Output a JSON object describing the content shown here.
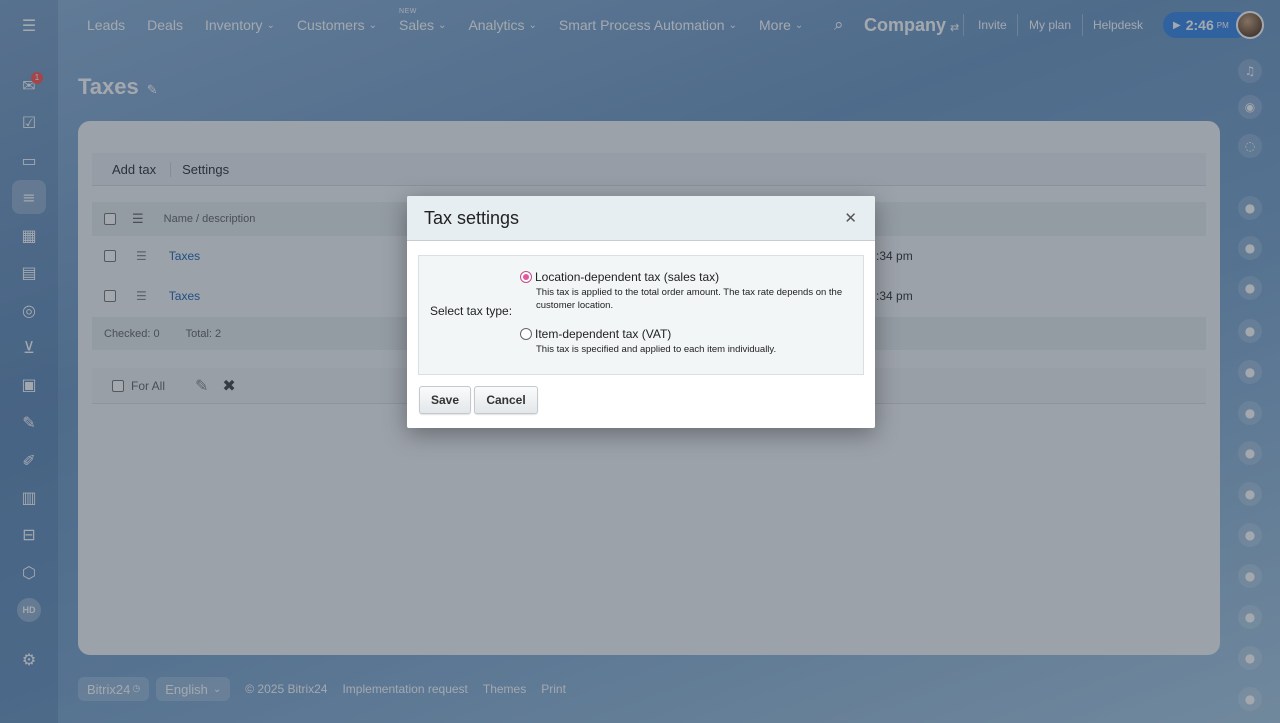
{
  "topnav": {
    "items": [
      {
        "label": "Leads",
        "chevron": false,
        "new": ""
      },
      {
        "label": "Deals",
        "chevron": false,
        "new": ""
      },
      {
        "label": "Inventory",
        "chevron": true,
        "new": ""
      },
      {
        "label": "Customers",
        "chevron": true,
        "new": ""
      },
      {
        "label": "Sales",
        "chevron": true,
        "new": "NEW"
      },
      {
        "label": "Analytics",
        "chevron": true,
        "new": ""
      },
      {
        "label": "Smart Process Automation",
        "chevron": true,
        "new": ""
      },
      {
        "label": "More",
        "chevron": true,
        "new": ""
      }
    ],
    "company": "Company",
    "invite": "Invite",
    "my_plan": "My plan",
    "helpdesk": "Helpdesk",
    "time": "2:46",
    "time_suffix": "PM"
  },
  "left_bar": {
    "badge": "1",
    "hd_label": "HD",
    "icons": [
      "menu-icon",
      "chat-icon",
      "tasks-icon",
      "feed-icon",
      "crm-icon",
      "calendar-icon",
      "drive-icon",
      "target-icon",
      "cart-icon",
      "contact-center-icon",
      "sign-icon",
      "edit-icon",
      "analytics-icon",
      "robot-icon",
      "box-icon",
      "settings-icon"
    ]
  },
  "page": {
    "title": "Taxes",
    "toolbar": {
      "add_tax": "Add tax",
      "settings": "Settings"
    },
    "grid": {
      "column_name": "Name / description",
      "rows": [
        {
          "name": "Taxes",
          "date": ":34 pm"
        },
        {
          "name": "Taxes",
          "date": ":34 pm"
        }
      ],
      "checked": "Checked: 0",
      "total": "Total: 2",
      "for_all": "For All"
    }
  },
  "footer": {
    "brand": "Bitrix24",
    "language": "English",
    "copyright": "© 2025 Bitrix24",
    "implementation": "Implementation request",
    "themes": "Themes",
    "print": "Print"
  },
  "dialog": {
    "title": "Tax settings",
    "select_label": "Select tax type:",
    "options": [
      {
        "title": "Location-dependent tax (sales tax)",
        "desc": "This tax is applied to the total order amount. The tax rate depends on the customer location.",
        "selected": true
      },
      {
        "title": "Item-dependent tax (VAT)",
        "desc": "This tax is specified and applied to each item individually.",
        "selected": false
      }
    ],
    "save": "Save",
    "cancel": "Cancel"
  },
  "colors": {
    "accent_pink": "#e0589e",
    "time_pill": "#3b87e6",
    "link": "#2067b0"
  }
}
